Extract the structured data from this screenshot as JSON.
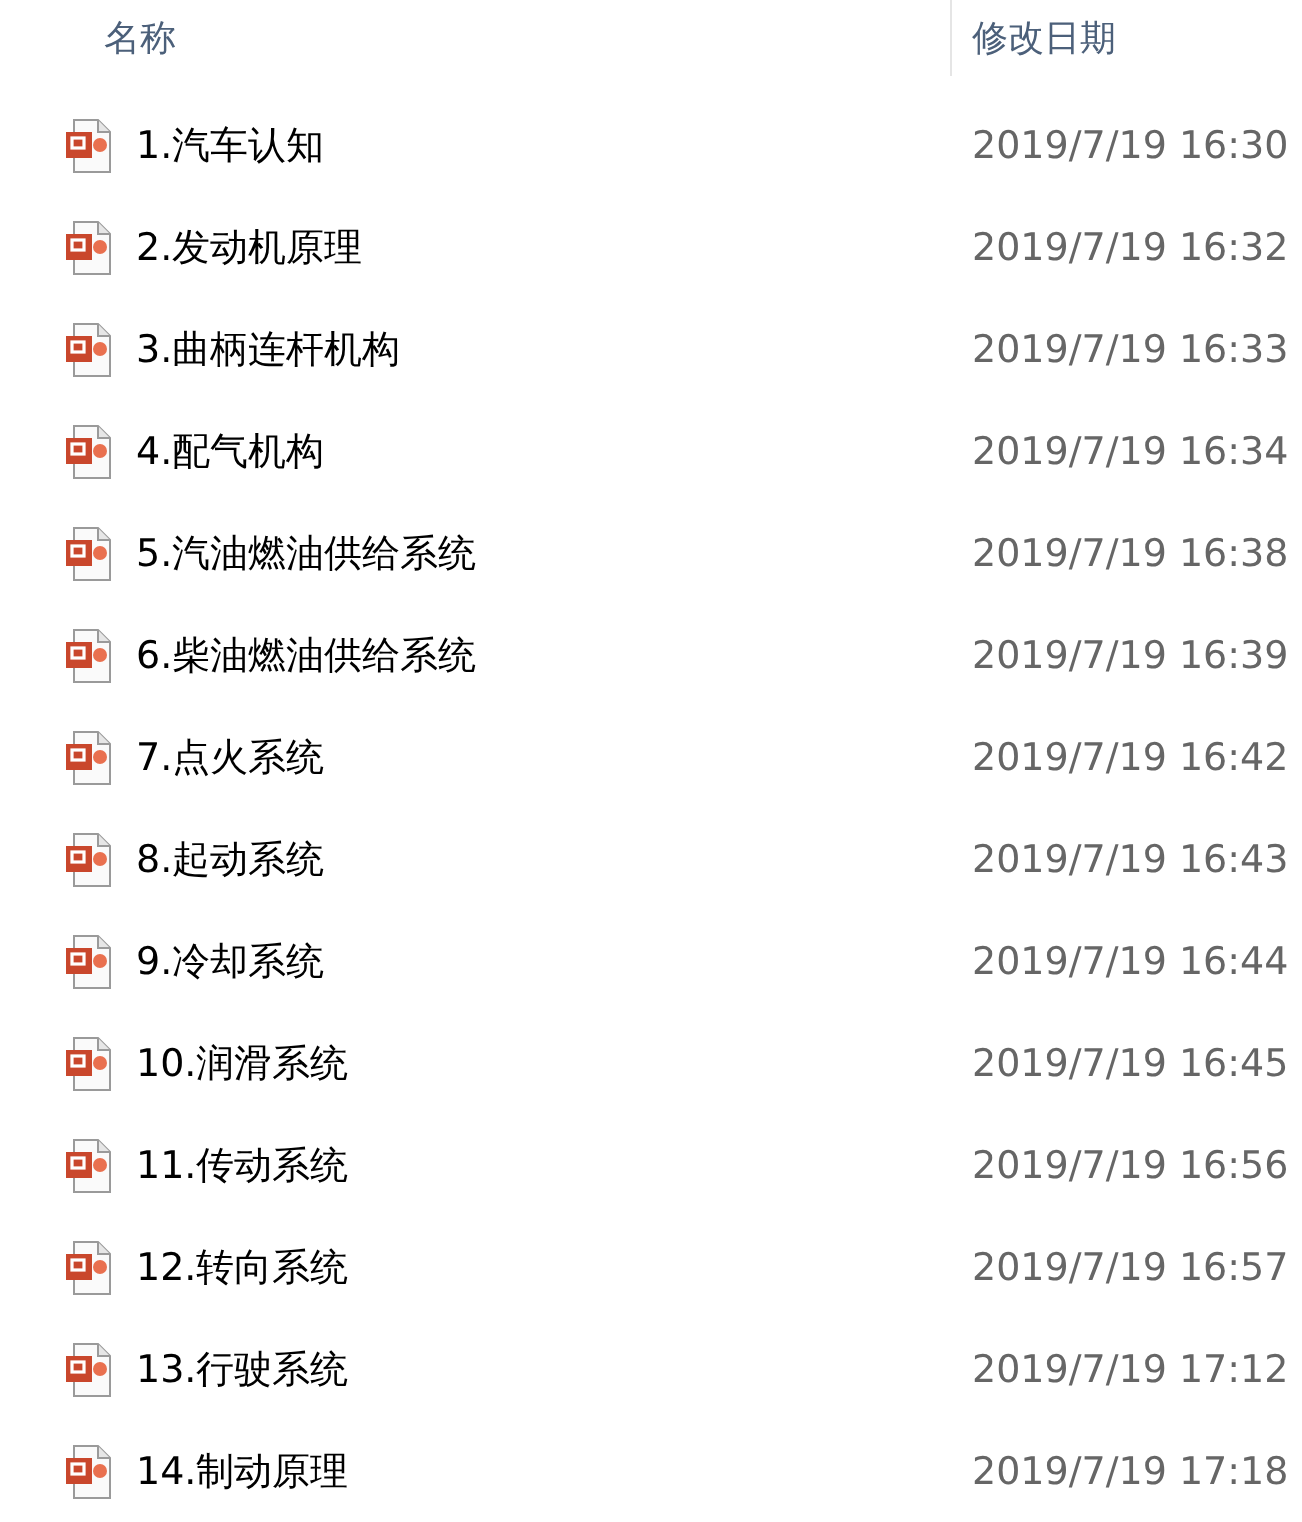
{
  "columns": [
    "名称",
    "修改日期"
  ],
  "rows": [
    {
      "name": "1.汽车认知",
      "date": "2019/7/19 16:30"
    },
    {
      "name": "2.发动机原理",
      "date": "2019/7/19 16:32"
    },
    {
      "name": "3.曲柄连杆机构",
      "date": "2019/7/19 16:33"
    },
    {
      "name": "4.配气机构",
      "date": "2019/7/19 16:34"
    },
    {
      "name": "5.汽油燃油供给系统",
      "date": "2019/7/19 16:38"
    },
    {
      "name": "6.柴油燃油供给系统",
      "date": "2019/7/19 16:39"
    },
    {
      "name": "7.点火系统",
      "date": "2019/7/19 16:42"
    },
    {
      "name": "8.起动系统",
      "date": "2019/7/19 16:43"
    },
    {
      "name": "9.冷却系统",
      "date": "2019/7/19 16:44"
    },
    {
      "name": "10.润滑系统",
      "date": "2019/7/19 16:45"
    },
    {
      "name": "11.传动系统",
      "date": "2019/7/19 16:56"
    },
    {
      "name": "12.转向系统",
      "date": "2019/7/19 16:57"
    },
    {
      "name": "13.行驶系统",
      "date": "2019/7/19 17:12"
    },
    {
      "name": "14.制动原理",
      "date": "2019/7/19 17:18"
    }
  ]
}
